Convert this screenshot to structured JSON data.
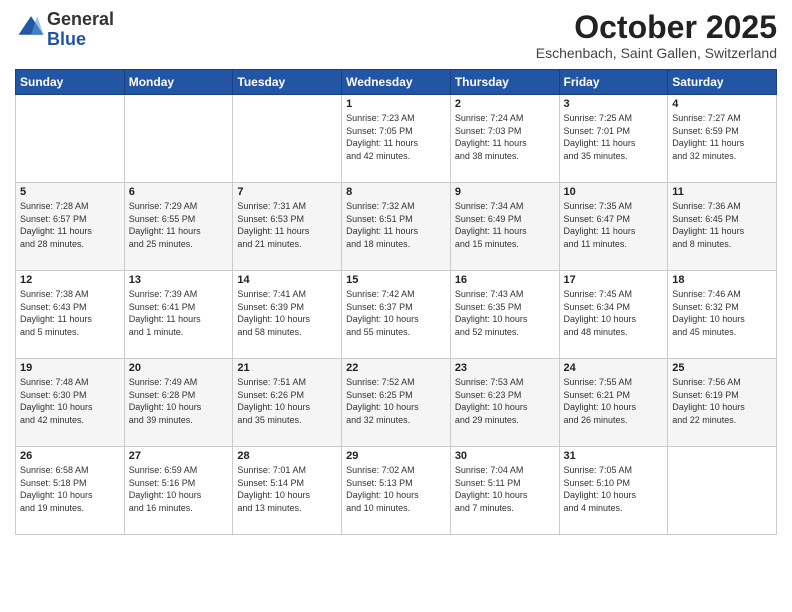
{
  "header": {
    "logo_general": "General",
    "logo_blue": "Blue",
    "month": "October 2025",
    "location": "Eschenbach, Saint Gallen, Switzerland"
  },
  "days_of_week": [
    "Sunday",
    "Monday",
    "Tuesday",
    "Wednesday",
    "Thursday",
    "Friday",
    "Saturday"
  ],
  "weeks": [
    [
      {
        "day": "",
        "info": ""
      },
      {
        "day": "",
        "info": ""
      },
      {
        "day": "",
        "info": ""
      },
      {
        "day": "1",
        "info": "Sunrise: 7:23 AM\nSunset: 7:05 PM\nDaylight: 11 hours\nand 42 minutes."
      },
      {
        "day": "2",
        "info": "Sunrise: 7:24 AM\nSunset: 7:03 PM\nDaylight: 11 hours\nand 38 minutes."
      },
      {
        "day": "3",
        "info": "Sunrise: 7:25 AM\nSunset: 7:01 PM\nDaylight: 11 hours\nand 35 minutes."
      },
      {
        "day": "4",
        "info": "Sunrise: 7:27 AM\nSunset: 6:59 PM\nDaylight: 11 hours\nand 32 minutes."
      }
    ],
    [
      {
        "day": "5",
        "info": "Sunrise: 7:28 AM\nSunset: 6:57 PM\nDaylight: 11 hours\nand 28 minutes."
      },
      {
        "day": "6",
        "info": "Sunrise: 7:29 AM\nSunset: 6:55 PM\nDaylight: 11 hours\nand 25 minutes."
      },
      {
        "day": "7",
        "info": "Sunrise: 7:31 AM\nSunset: 6:53 PM\nDaylight: 11 hours\nand 21 minutes."
      },
      {
        "day": "8",
        "info": "Sunrise: 7:32 AM\nSunset: 6:51 PM\nDaylight: 11 hours\nand 18 minutes."
      },
      {
        "day": "9",
        "info": "Sunrise: 7:34 AM\nSunset: 6:49 PM\nDaylight: 11 hours\nand 15 minutes."
      },
      {
        "day": "10",
        "info": "Sunrise: 7:35 AM\nSunset: 6:47 PM\nDaylight: 11 hours\nand 11 minutes."
      },
      {
        "day": "11",
        "info": "Sunrise: 7:36 AM\nSunset: 6:45 PM\nDaylight: 11 hours\nand 8 minutes."
      }
    ],
    [
      {
        "day": "12",
        "info": "Sunrise: 7:38 AM\nSunset: 6:43 PM\nDaylight: 11 hours\nand 5 minutes."
      },
      {
        "day": "13",
        "info": "Sunrise: 7:39 AM\nSunset: 6:41 PM\nDaylight: 11 hours\nand 1 minute."
      },
      {
        "day": "14",
        "info": "Sunrise: 7:41 AM\nSunset: 6:39 PM\nDaylight: 10 hours\nand 58 minutes."
      },
      {
        "day": "15",
        "info": "Sunrise: 7:42 AM\nSunset: 6:37 PM\nDaylight: 10 hours\nand 55 minutes."
      },
      {
        "day": "16",
        "info": "Sunrise: 7:43 AM\nSunset: 6:35 PM\nDaylight: 10 hours\nand 52 minutes."
      },
      {
        "day": "17",
        "info": "Sunrise: 7:45 AM\nSunset: 6:34 PM\nDaylight: 10 hours\nand 48 minutes."
      },
      {
        "day": "18",
        "info": "Sunrise: 7:46 AM\nSunset: 6:32 PM\nDaylight: 10 hours\nand 45 minutes."
      }
    ],
    [
      {
        "day": "19",
        "info": "Sunrise: 7:48 AM\nSunset: 6:30 PM\nDaylight: 10 hours\nand 42 minutes."
      },
      {
        "day": "20",
        "info": "Sunrise: 7:49 AM\nSunset: 6:28 PM\nDaylight: 10 hours\nand 39 minutes."
      },
      {
        "day": "21",
        "info": "Sunrise: 7:51 AM\nSunset: 6:26 PM\nDaylight: 10 hours\nand 35 minutes."
      },
      {
        "day": "22",
        "info": "Sunrise: 7:52 AM\nSunset: 6:25 PM\nDaylight: 10 hours\nand 32 minutes."
      },
      {
        "day": "23",
        "info": "Sunrise: 7:53 AM\nSunset: 6:23 PM\nDaylight: 10 hours\nand 29 minutes."
      },
      {
        "day": "24",
        "info": "Sunrise: 7:55 AM\nSunset: 6:21 PM\nDaylight: 10 hours\nand 26 minutes."
      },
      {
        "day": "25",
        "info": "Sunrise: 7:56 AM\nSunset: 6:19 PM\nDaylight: 10 hours\nand 22 minutes."
      }
    ],
    [
      {
        "day": "26",
        "info": "Sunrise: 6:58 AM\nSunset: 5:18 PM\nDaylight: 10 hours\nand 19 minutes."
      },
      {
        "day": "27",
        "info": "Sunrise: 6:59 AM\nSunset: 5:16 PM\nDaylight: 10 hours\nand 16 minutes."
      },
      {
        "day": "28",
        "info": "Sunrise: 7:01 AM\nSunset: 5:14 PM\nDaylight: 10 hours\nand 13 minutes."
      },
      {
        "day": "29",
        "info": "Sunrise: 7:02 AM\nSunset: 5:13 PM\nDaylight: 10 hours\nand 10 minutes."
      },
      {
        "day": "30",
        "info": "Sunrise: 7:04 AM\nSunset: 5:11 PM\nDaylight: 10 hours\nand 7 minutes."
      },
      {
        "day": "31",
        "info": "Sunrise: 7:05 AM\nSunset: 5:10 PM\nDaylight: 10 hours\nand 4 minutes."
      },
      {
        "day": "",
        "info": ""
      }
    ]
  ]
}
